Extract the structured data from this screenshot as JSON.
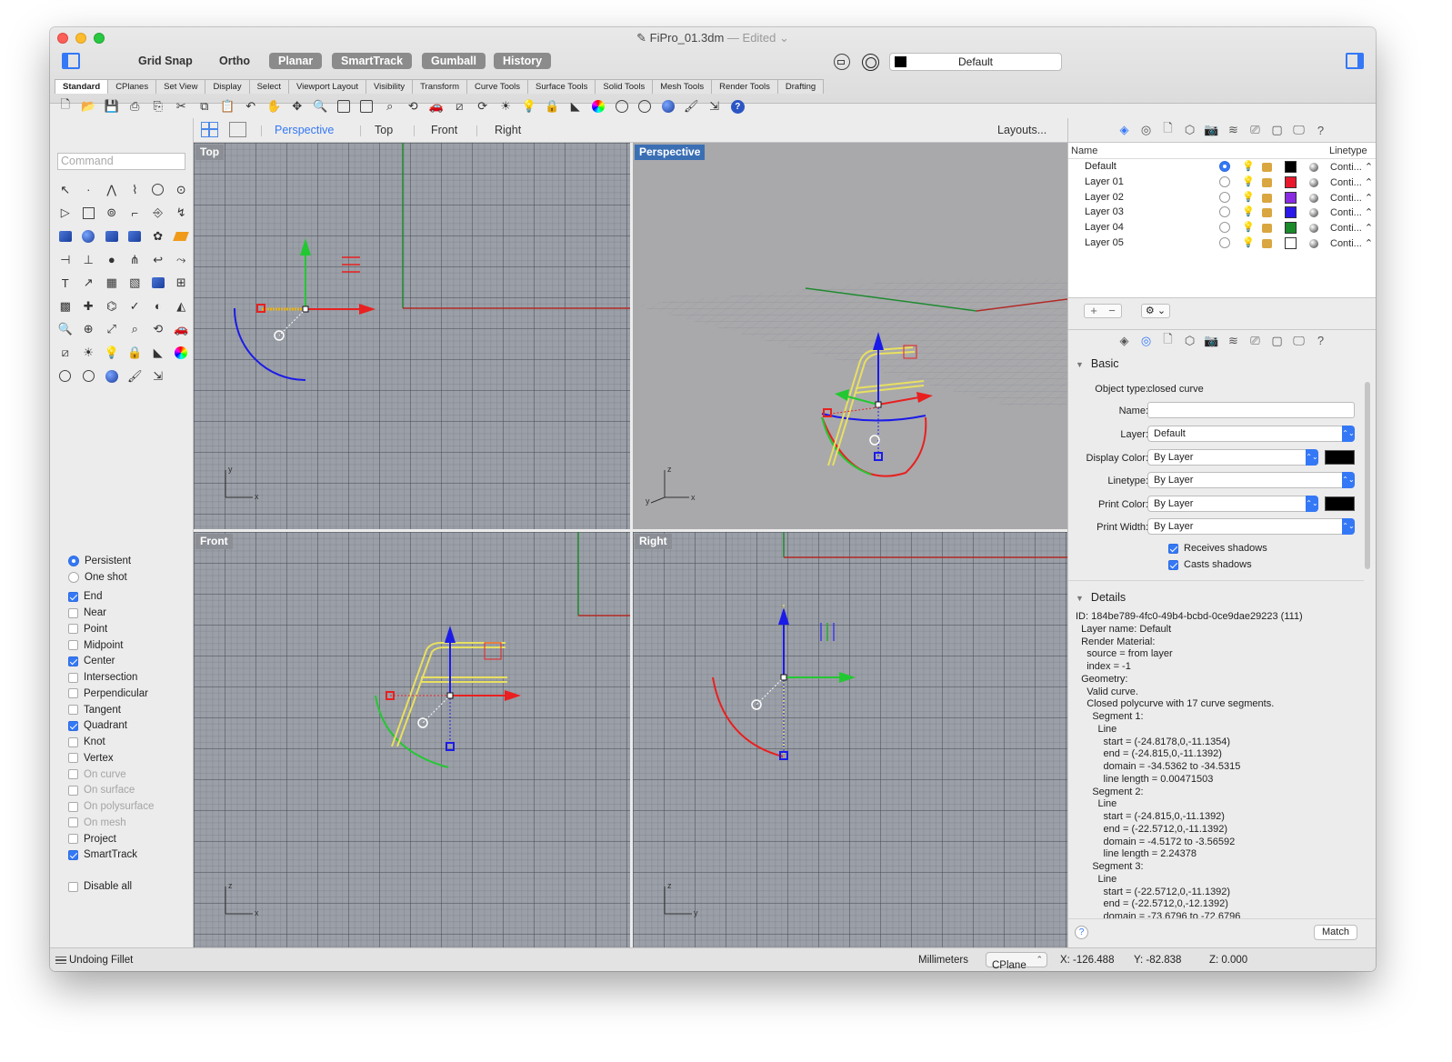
{
  "window": {
    "title": "FiPro_01.3dm",
    "status": "— Edited ⌄"
  },
  "toolbar": {
    "grid_snap": "Grid Snap",
    "ortho": "Ortho",
    "planar": "Planar",
    "smarttrack": "SmartTrack",
    "gumball": "Gumball",
    "history": "History",
    "current_layer": "Default"
  },
  "tabs": [
    "Standard",
    "CPlanes",
    "Set View",
    "Display",
    "Select",
    "Viewport Layout",
    "Visibility",
    "Transform",
    "Curve Tools",
    "Surface Tools",
    "Solid Tools",
    "Mesh Tools",
    "Render Tools",
    "Drafting"
  ],
  "command": {
    "placeholder": "Command"
  },
  "viewport_tabs": {
    "perspective": "Perspective",
    "top": "Top",
    "front": "Front",
    "right": "Right",
    "layouts": "Layouts..."
  },
  "viewports": {
    "top": "Top",
    "perspective": "Perspective",
    "front": "Front",
    "right": "Right"
  },
  "snaps": {
    "persistent": "Persistent",
    "one_shot": "One shot",
    "end": "End",
    "near": "Near",
    "point": "Point",
    "midpoint": "Midpoint",
    "center": "Center",
    "intersection": "Intersection",
    "perpendicular": "Perpendicular",
    "tangent": "Tangent",
    "quadrant": "Quadrant",
    "knot": "Knot",
    "vertex": "Vertex",
    "on_curve": "On curve",
    "on_surface": "On surface",
    "on_polysurface": "On polysurface",
    "on_mesh": "On mesh",
    "project": "Project",
    "smarttrack": "SmartTrack",
    "disable_all": "Disable all"
  },
  "layers": {
    "col_name": "Name",
    "col_linetype": "Linetype",
    "rows": [
      {
        "name": "Default",
        "color": "#000000",
        "linetype": "Conti... ⌃"
      },
      {
        "name": "Layer 01",
        "color": "#e8192c",
        "linetype": "Conti... ⌃"
      },
      {
        "name": "Layer 02",
        "color": "#8a2be2",
        "linetype": "Conti... ⌃"
      },
      {
        "name": "Layer 03",
        "color": "#2a19e8",
        "linetype": "Conti... ⌃"
      },
      {
        "name": "Layer 04",
        "color": "#1a8a2a",
        "linetype": "Conti... ⌃"
      },
      {
        "name": "Layer 05",
        "color": "#ffffff",
        "linetype": "Conti... ⌃"
      }
    ]
  },
  "properties": {
    "basic": "Basic",
    "object_type_label": "Object type:",
    "object_type": "closed curve",
    "name_label": "Name:",
    "layer_label": "Layer:",
    "layer": "Default",
    "display_color_label": "Display Color:",
    "display_color": "By Layer",
    "linetype_label": "Linetype:",
    "linetype": "By Layer",
    "print_color_label": "Print Color:",
    "print_color": "By Layer",
    "print_width_label": "Print Width:",
    "print_width": "By Layer",
    "receives_shadows": "Receives shadows",
    "casts_shadows": "Casts shadows",
    "details": "Details",
    "details_text": "ID: 184be789-4fc0-49b4-bcbd-0ce9dae29223 (111)\n  Layer name: Default\n  Render Material:\n    source = from layer\n    index = -1\n  Geometry:\n    Valid curve.\n    Closed polycurve with 17 curve segments.\n      Segment 1:\n        Line\n          start = (-24.8178,0,-11.1354)\n          end = (-24.815,0,-11.1392)\n          domain = -34.5362 to -34.5315\n          line length = 0.00471503\n      Segment 2:\n        Line\n          start = (-24.815,0,-11.1392)\n          end = (-22.5712,0,-11.1392)\n          domain = -4.5172 to -3.56592\n          line length = 2.24378\n      Segment 3:\n        Line\n          start = (-22.5712,0,-11.1392)\n          end = (-22.5712,0,-12.1392)\n          domain = -73.6796 to -72.6796",
    "match": "Match",
    "help": "?"
  },
  "statusbar": {
    "message": "Undoing Fillet",
    "units": "Millimeters",
    "cplane": "CPlane",
    "x": "X: -126.488",
    "y": "Y: -82.838",
    "z": "Z: 0.000"
  }
}
